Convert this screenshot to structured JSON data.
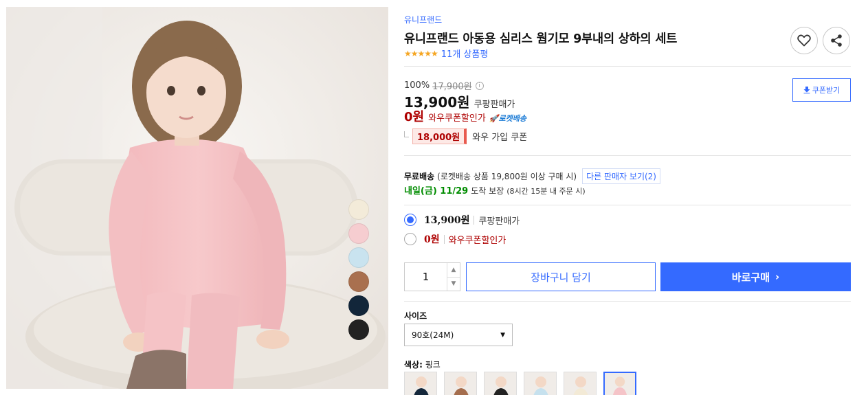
{
  "product": {
    "brand": "유니프랜드",
    "title": "유니프랜드 아동용 심리스 웜기모 9부내의 상하의 세트",
    "stars": "★★★★★",
    "review_count": "11개 상품평"
  },
  "price": {
    "discount_rate": "100%",
    "original_price": "17,900원",
    "info_icon": "ⓘ",
    "sale_price": "13,900원",
    "sale_label": "쿠팡판매가",
    "wow_price": "0원",
    "wow_label": "와우쿠폰할인가",
    "rocket_badge": "🚀로켓배송",
    "coupon_amount": "18,000원",
    "coupon_label": "와우 가입 쿠폰",
    "coupon_download": "쿠폰받기"
  },
  "shipping": {
    "free_label": "무료배송",
    "condition": "(로켓배송 상품 19,800원 이상 구매 시)",
    "other_sellers": "다른 판매자 보기(2)",
    "arrival_date": "내일(금) 11/29",
    "arrival_guarantee": "도착 보장",
    "arrival_deadline": "(8시간 15분 내 주문 시)"
  },
  "price_options": [
    {
      "price": "13,900원",
      "label": "쿠팡판매가",
      "selected": true,
      "label_color": "#333333"
    },
    {
      "price": "0원",
      "label": "와우쿠폰할인가",
      "selected": false,
      "label_color": "#ae0000"
    }
  ],
  "purchase": {
    "quantity": "1",
    "add_to_cart": "장바구니 담기",
    "buy_now": "바로구매",
    "buy_now_chevron": "›"
  },
  "size": {
    "label": "사이즈",
    "selected": "90호(24M)"
  },
  "color": {
    "label": "색상:",
    "selected": "핑크",
    "thumbnails": [
      "navy",
      "brown",
      "black",
      "sky",
      "cream",
      "pink"
    ],
    "selected_index": 5
  },
  "swatches": [
    {
      "name": "cream",
      "color": "#f3ebd9"
    },
    {
      "name": "pink",
      "color": "#f6cdd0"
    },
    {
      "name": "sky",
      "color": "#c9e3ef"
    },
    {
      "name": "brown",
      "color": "#a9704f"
    },
    {
      "name": "navy",
      "color": "#12263a"
    },
    {
      "name": "black",
      "color": "#222222"
    }
  ],
  "colors": {
    "accent": "#346aff",
    "wow_red": "#ae0000",
    "arrival_green": "#008c00",
    "star": "#f5a623"
  }
}
